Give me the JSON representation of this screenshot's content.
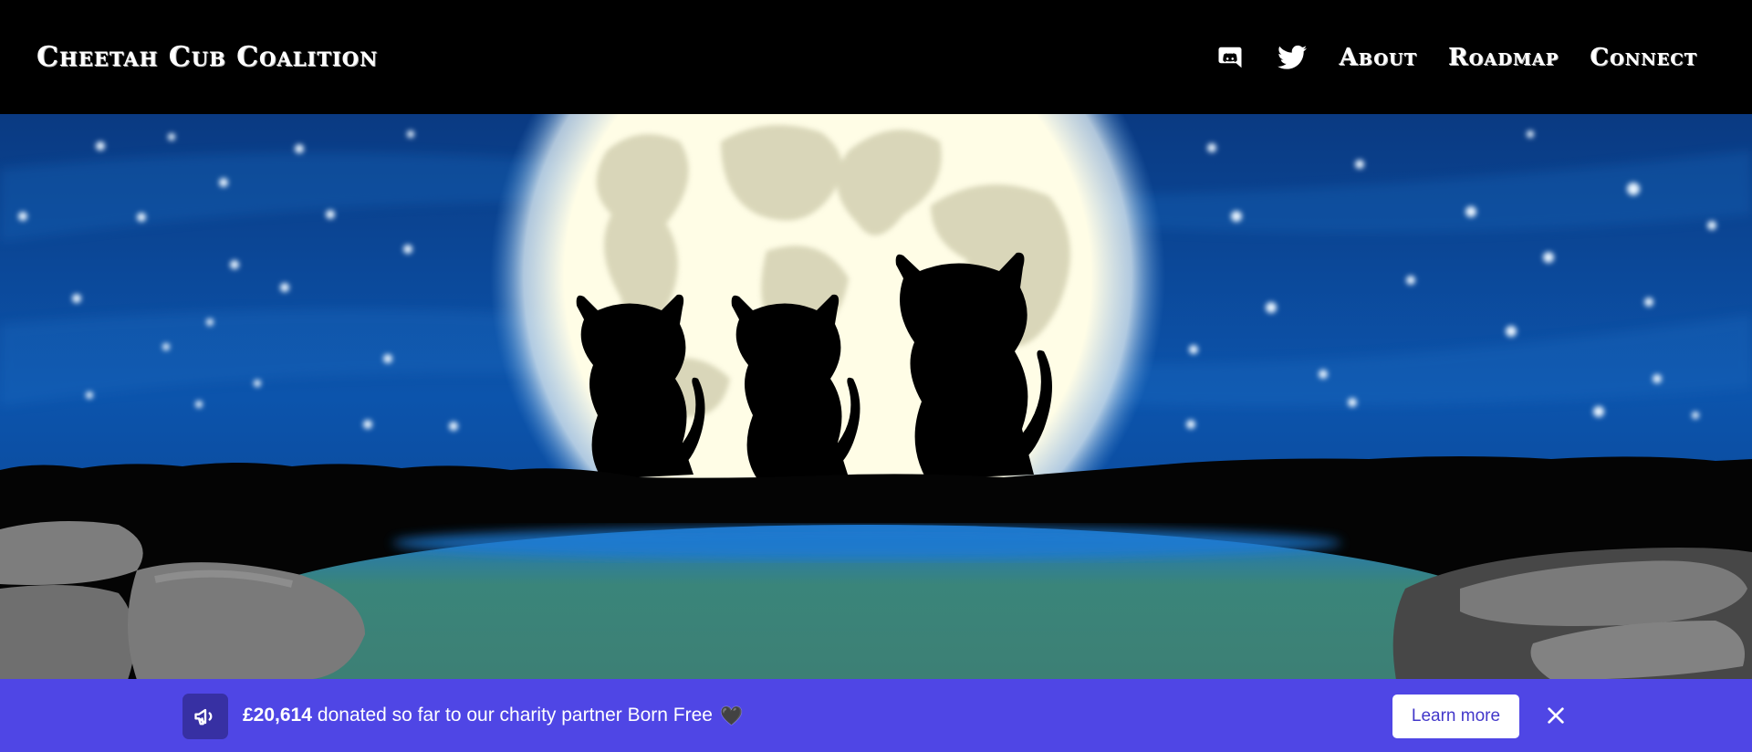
{
  "header": {
    "brand": "Cheetah Cub Coalition",
    "nav": {
      "discord_icon": "discord-icon",
      "twitter_icon": "twitter-icon",
      "about": "About",
      "roadmap": "Roadmap",
      "connect": "Connect"
    }
  },
  "hero": {
    "scene": "night-sky-moon-three-cubs-pond"
  },
  "banner": {
    "icon": "megaphone-icon",
    "amount": "£20,614",
    "message": "donated so far to our charity partner Born Free",
    "heart": "🖤",
    "learn_more": "Learn more",
    "close_icon": "close-icon"
  },
  "colors": {
    "header_bg": "#000000",
    "banner_bg": "#4f46e5",
    "banner_icon_bg": "#3730a3",
    "sky": "#0b4aa0",
    "moon": "#fbfae0",
    "pond": "#3b8078"
  }
}
